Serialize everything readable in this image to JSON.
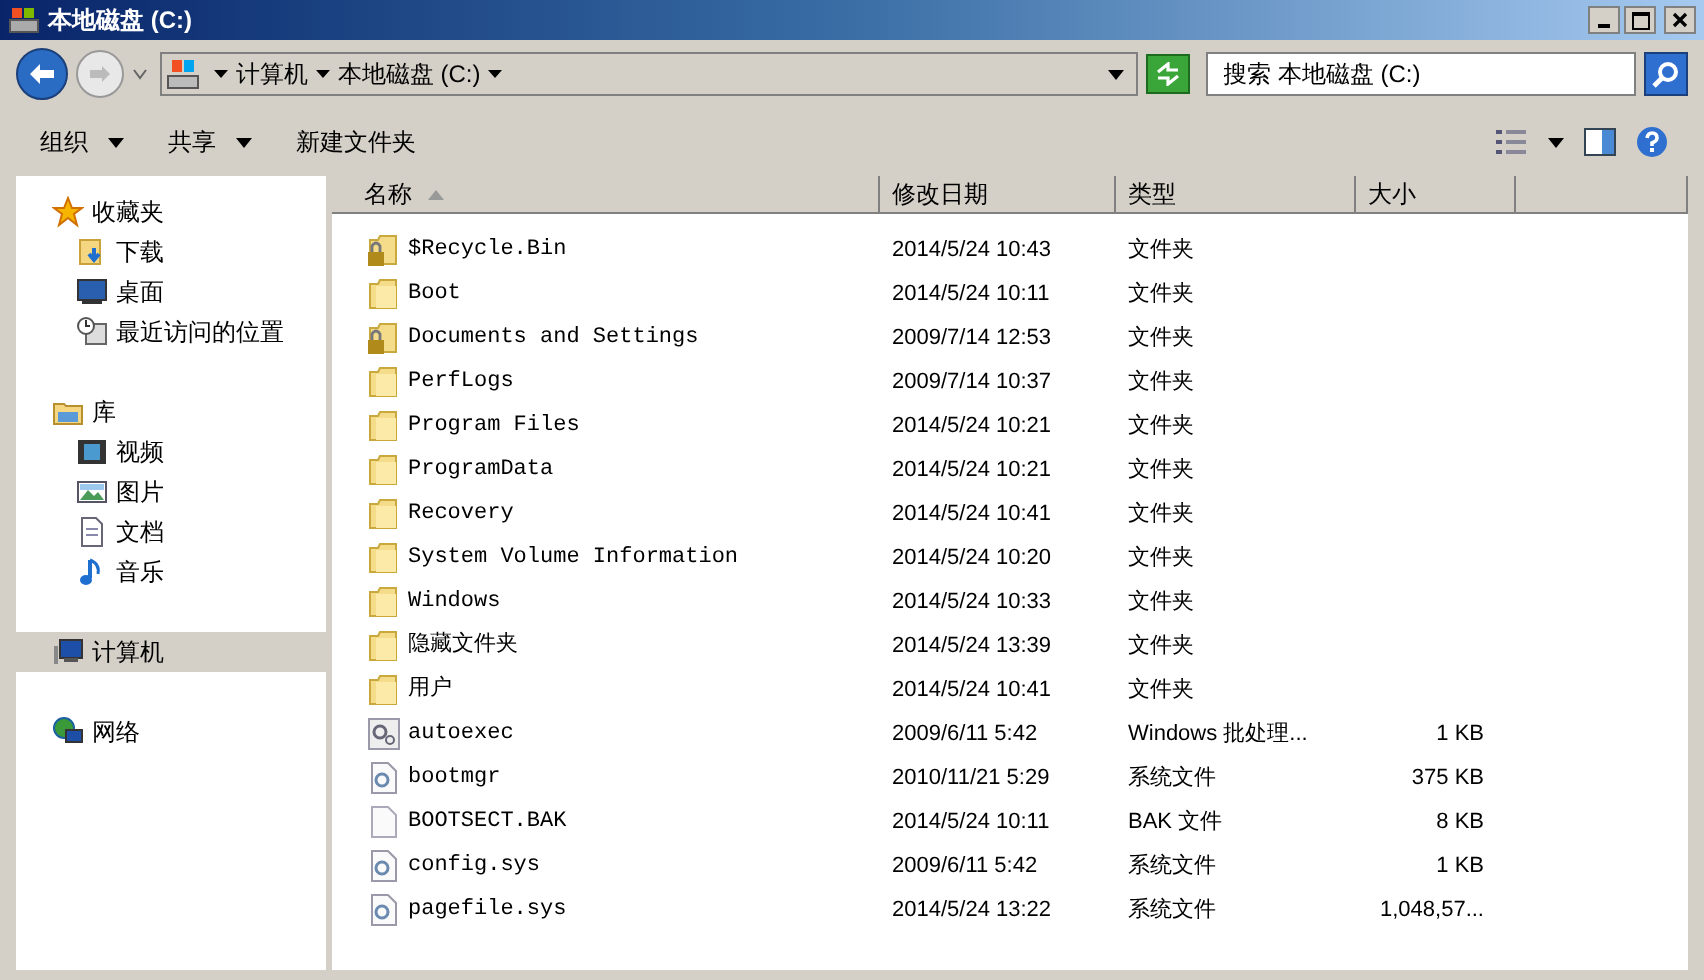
{
  "window": {
    "title": "本地磁盘 (C:)"
  },
  "address": {
    "crumbs": [
      "计算机",
      "本地磁盘 (C:)"
    ]
  },
  "search": {
    "placeholder": "搜索 本地磁盘 (C:)"
  },
  "toolbar": {
    "buttons": [
      {
        "label": "组织",
        "dropdown": true
      },
      {
        "label": "共享",
        "dropdown": true
      },
      {
        "label": "新建文件夹",
        "dropdown": false
      }
    ]
  },
  "sidebar": {
    "groups": [
      {
        "label": "收藏夹",
        "kind": "star",
        "selected": false,
        "children": [
          {
            "label": "下载",
            "kind": "download",
            "selected": false
          },
          {
            "label": "桌面",
            "kind": "desktop",
            "selected": false
          },
          {
            "label": "最近访问的位置",
            "kind": "recent",
            "selected": false
          }
        ]
      },
      {
        "label": "库",
        "kind": "library",
        "selected": false,
        "children": [
          {
            "label": "视频",
            "kind": "video",
            "selected": false
          },
          {
            "label": "图片",
            "kind": "image",
            "selected": false
          },
          {
            "label": "文档",
            "kind": "doc",
            "selected": false
          },
          {
            "label": "音乐",
            "kind": "music",
            "selected": false
          }
        ]
      },
      {
        "label": "计算机",
        "kind": "computer",
        "selected": true
      },
      {
        "label": "网络",
        "kind": "network",
        "selected": false
      }
    ]
  },
  "table": {
    "columns": [
      {
        "label": "名称",
        "sorted": true
      },
      {
        "label": "修改日期",
        "sorted": false
      },
      {
        "label": "类型",
        "sorted": false
      },
      {
        "label": "大小",
        "sorted": false
      }
    ],
    "rows": [
      {
        "kind": "locked-folder",
        "name": "$Recycle.Bin",
        "date": "2014/5/24 10:43",
        "type": "文件夹"
      },
      {
        "kind": "folder",
        "name": "Boot",
        "date": "2014/5/24 10:11",
        "type": "文件夹"
      },
      {
        "kind": "locked-folder",
        "name": "Documents and Settings",
        "date": "2009/7/14 12:53",
        "type": "文件夹"
      },
      {
        "kind": "folder",
        "name": "PerfLogs",
        "date": "2009/7/14 10:37",
        "type": "文件夹"
      },
      {
        "kind": "folder",
        "name": "Program Files",
        "date": "2014/5/24 10:21",
        "type": "文件夹"
      },
      {
        "kind": "folder",
        "name": "ProgramData",
        "date": "2014/5/24 10:21",
        "type": "文件夹"
      },
      {
        "kind": "folder",
        "name": "Recovery",
        "date": "2014/5/24 10:41",
        "type": "文件夹"
      },
      {
        "kind": "folder",
        "name": "System Volume Information",
        "date": "2014/5/24 10:20",
        "type": "文件夹"
      },
      {
        "kind": "folder",
        "name": "Windows",
        "date": "2014/5/24 10:33",
        "type": "文件夹"
      },
      {
        "kind": "folder",
        "name": "隐藏文件夹",
        "date": "2014/5/24 13:39",
        "type": "文件夹"
      },
      {
        "kind": "folder",
        "name": "用户",
        "date": "2014/5/24 10:41",
        "type": "文件夹"
      },
      {
        "kind": "batch",
        "name": "autoexec",
        "date": "2009/6/11 5:42",
        "type": "Windows 批处理...",
        "size": "1 KB"
      },
      {
        "kind": "system",
        "name": "bootmgr",
        "date": "2010/11/21 5:29",
        "type": "系统文件",
        "size": "375 KB"
      },
      {
        "kind": "file",
        "name": "BOOTSECT.BAK",
        "date": "2014/5/24 10:11",
        "type": "BAK 文件",
        "size": "8 KB"
      },
      {
        "kind": "system",
        "name": "config.sys",
        "date": "2009/6/11 5:42",
        "type": "系统文件",
        "size": "1 KB"
      },
      {
        "kind": "system",
        "name": "pagefile.sys",
        "date": "2014/5/24 13:22",
        "type": "系统文件",
        "size": "1,048,57..."
      }
    ]
  }
}
